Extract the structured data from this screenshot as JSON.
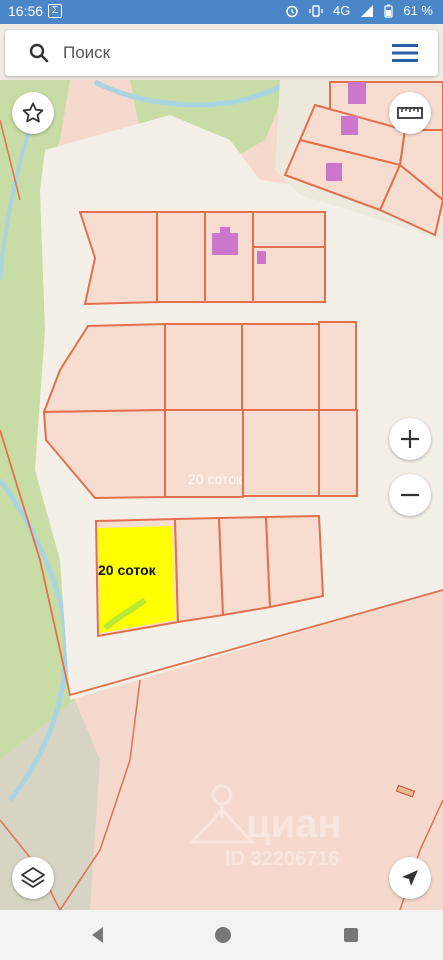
{
  "status_bar": {
    "time": "16:56",
    "sim_icon": "Σ",
    "network": "4G",
    "battery": "61 %"
  },
  "search": {
    "placeholder": "Поиск"
  },
  "map": {
    "plot_label_highlight": "20 соток",
    "plot_label_ghost": "20 соток",
    "watermark_brand": "циан",
    "watermark_id": "ID 32206716"
  },
  "colors": {
    "status_bar": "#4a86c8",
    "accent": "#2a5ea8",
    "parcel_line": "#e2704e",
    "parcel_fill": "#f7dcd0",
    "building": "#cc77cc",
    "highlight": "#ffff00",
    "forest": "#c9dea7",
    "river": "#a9d4e0"
  },
  "icons": {
    "search": "search-icon",
    "menu": "menu-icon",
    "favorite": "star-icon",
    "ruler": "ruler-icon",
    "zoom_in": "plus-icon",
    "zoom_out": "minus-icon",
    "layers": "layers-icon",
    "location": "navigation-arrow-icon"
  }
}
